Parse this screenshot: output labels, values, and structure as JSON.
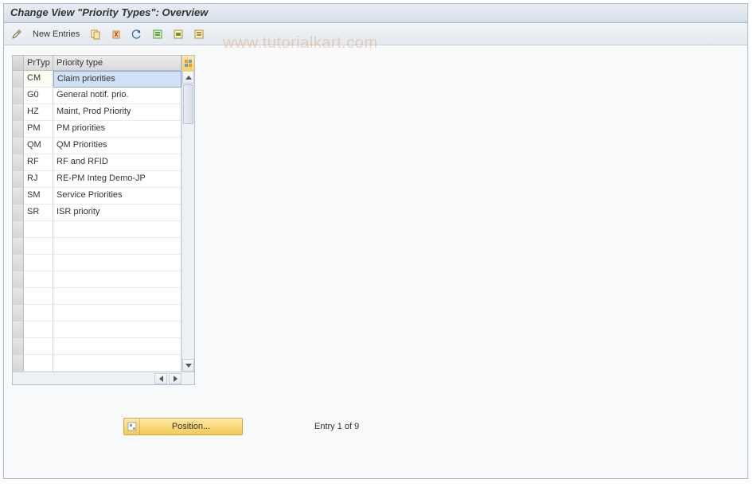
{
  "header": {
    "title": "Change View \"Priority Types\": Overview"
  },
  "toolbar": {
    "new_entries_label": "New Entries"
  },
  "watermark": "www.tutorialkart.com",
  "grid": {
    "columns": {
      "code": "PrTyp",
      "name": "Priority type"
    },
    "rows": [
      {
        "code": "CM",
        "name": "Claim priorities",
        "selected": true
      },
      {
        "code": "G0",
        "name": "General notif. prio."
      },
      {
        "code": "HZ",
        "name": "Maint, Prod Priority"
      },
      {
        "code": "PM",
        "name": "PM priorities"
      },
      {
        "code": "QM",
        "name": "QM Priorities"
      },
      {
        "code": "RF",
        "name": "RF and RFID"
      },
      {
        "code": "RJ",
        "name": "RE-PM Integ Demo-JP"
      },
      {
        "code": "SM",
        "name": "Service Priorities"
      },
      {
        "code": "SR",
        "name": "ISR priority"
      },
      {
        "code": "",
        "name": ""
      },
      {
        "code": "",
        "name": ""
      },
      {
        "code": "",
        "name": ""
      },
      {
        "code": "",
        "name": ""
      },
      {
        "code": "",
        "name": ""
      },
      {
        "code": "",
        "name": ""
      },
      {
        "code": "",
        "name": ""
      },
      {
        "code": "",
        "name": ""
      },
      {
        "code": "",
        "name": ""
      }
    ]
  },
  "footer": {
    "position_label": "Position...",
    "status": "Entry 1 of 9"
  }
}
